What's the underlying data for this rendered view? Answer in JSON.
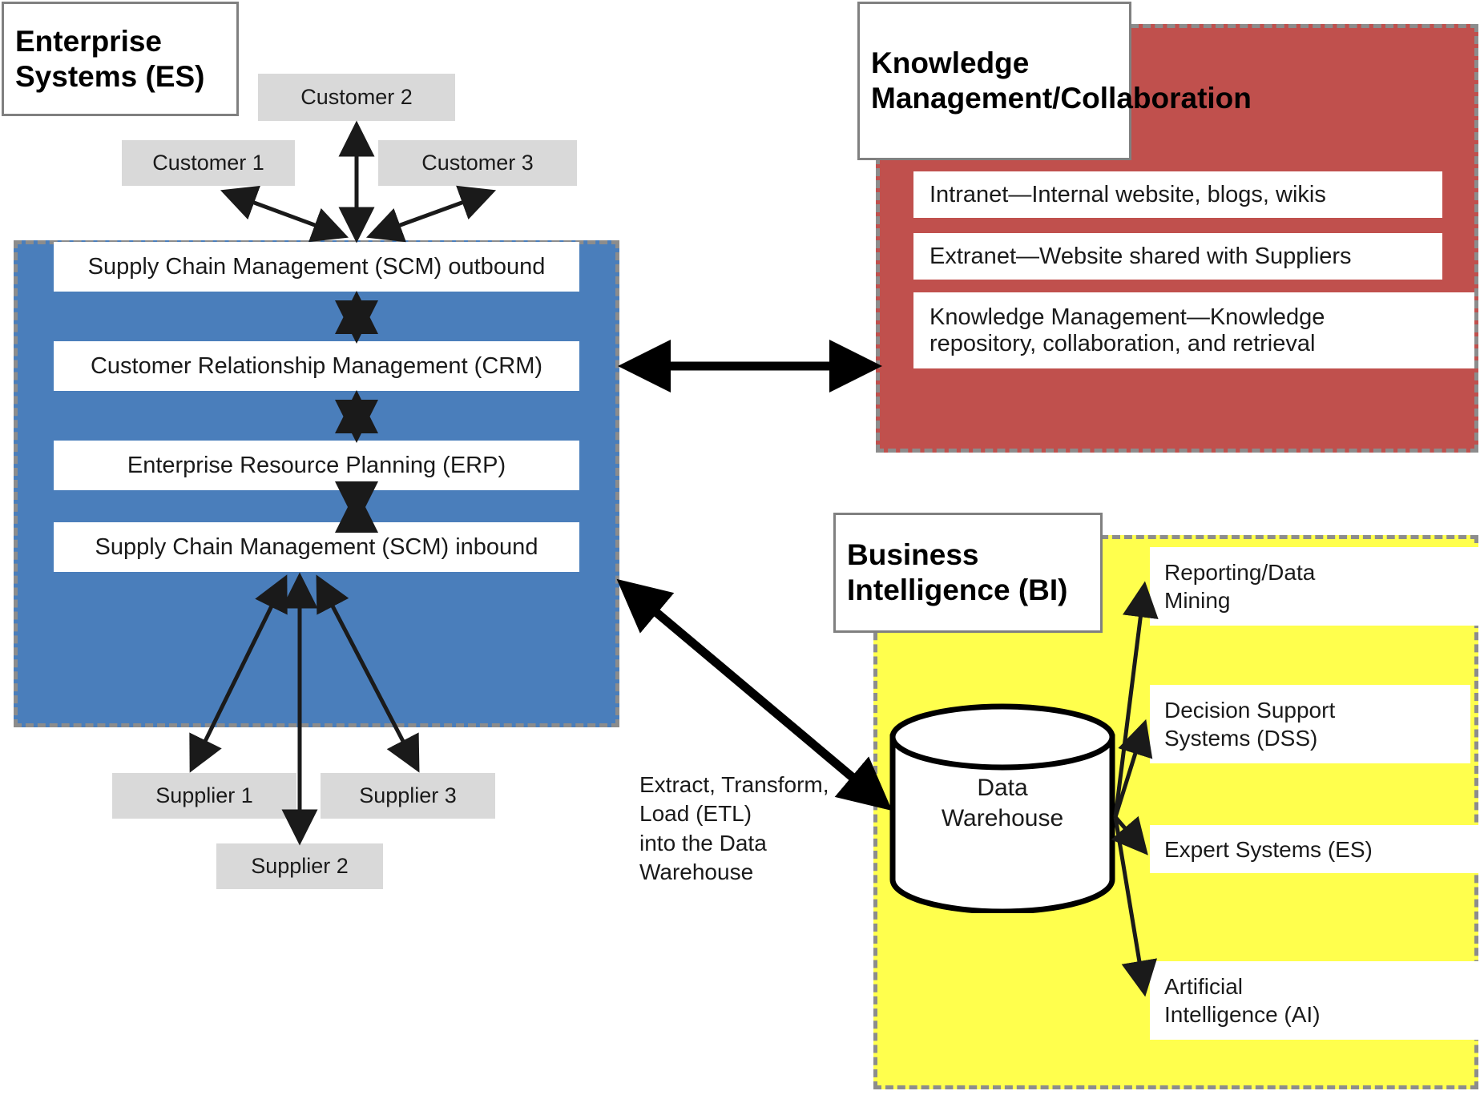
{
  "diagram": {
    "title": "Enterprise Systems, Knowledge Management/Collaboration and Business Intelligence architecture",
    "colors": {
      "enterprise_systems_panel": "#4a7ebb",
      "knowledge_management_panel": "#c0504d",
      "business_intelligence_panel": "#ffff4d",
      "external_entity_box": "#d9d9d9",
      "panel_border": "#8c8c8c",
      "component_box": "#ffffff",
      "connector": "#000000"
    }
  },
  "enterprise_systems": {
    "title": "Enterprise Systems (ES)",
    "customers": [
      {
        "label": "Customer 1"
      },
      {
        "label": "Customer 2"
      },
      {
        "label": "Customer 3"
      }
    ],
    "components": [
      {
        "label": "Supply Chain Management (SCM) outbound"
      },
      {
        "label": "Customer Relationship Management (CRM)"
      },
      {
        "label": "Enterprise Resource Planning (ERP)"
      },
      {
        "label": "Supply Chain Management (SCM) inbound"
      }
    ],
    "suppliers": [
      {
        "label": "Supplier 1"
      },
      {
        "label": "Supplier 2"
      },
      {
        "label": "Supplier 3"
      }
    ]
  },
  "knowledge_management": {
    "title": "Knowledge Management/Collaboration",
    "components": [
      {
        "label": "Intranet—Internal website, blogs, wikis"
      },
      {
        "label": "Extranet—Website shared with Suppliers"
      },
      {
        "line1": "Knowledge Management—Knowledge",
        "line2": "repository, collaboration, and retrieval"
      }
    ]
  },
  "business_intelligence": {
    "title": "Business Intelligence (BI)",
    "data_store": {
      "line1": "Data",
      "line2": "Warehouse"
    },
    "components": [
      {
        "line1": "Reporting/Data",
        "line2": "Mining"
      },
      {
        "line1": "Decision Support",
        "line2": "Systems (DSS)"
      },
      {
        "line1": "Expert Systems (ES)",
        "line2": ""
      },
      {
        "line1": "Artificial",
        "line2": "Intelligence (AI)"
      }
    ]
  },
  "connectors": {
    "etl_note": {
      "line1": "Extract, Transform,",
      "line2": "Load (ETL)",
      "line3": "into the Data",
      "line4": "Warehouse"
    }
  }
}
